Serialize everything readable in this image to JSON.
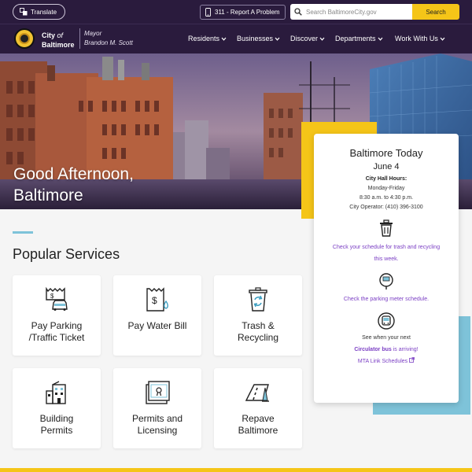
{
  "topbar": {
    "translate_label": "Translate",
    "report_label": "311 - Report A Problem",
    "search_placeholder": "Search BaltimoreCity.gov",
    "search_button": "Search"
  },
  "brand": {
    "city_line1_prefix": "City",
    "city_line1_of": "of",
    "city_line2": "Baltimore",
    "mayor_title": "Mayor",
    "mayor_name": "Brandon M. Scott"
  },
  "nav": {
    "items": [
      {
        "label": "Residents"
      },
      {
        "label": "Businesses"
      },
      {
        "label": "Discover"
      },
      {
        "label": "Departments"
      },
      {
        "label": "Work With Us"
      }
    ]
  },
  "hero": {
    "greeting_line1": "Good Afternoon,",
    "greeting_line2": "Baltimore"
  },
  "today": {
    "title": "Baltimore Today",
    "date": "June 4",
    "hours_title": "City Hall Hours:",
    "hours_days": "Monday-Friday",
    "hours_time": "8:30 a.m. to 4:30 p.m.",
    "operator": "City Operator: (410) 396-3100",
    "trash_link_line1": "Check your schedule for trash and recycling",
    "trash_link_line2": "this week.",
    "parking_link": "Check the parking meter schedule.",
    "bus_text": "See when your next",
    "bus_link": "Circulator bus",
    "bus_text2": " is arriving!",
    "mta_link": "MTA Link Schedules"
  },
  "services": {
    "title": "Popular Services",
    "items": [
      {
        "line1": "Pay Parking",
        "line2": "/Traffic Ticket",
        "icon": "parking-ticket-icon"
      },
      {
        "line1": "Pay Water Bill",
        "line2": "",
        "icon": "water-bill-icon"
      },
      {
        "line1": "Trash &",
        "line2": "Recycling",
        "icon": "recycling-bin-icon"
      },
      {
        "line1": "Building",
        "line2": "Permits",
        "icon": "building-icon"
      },
      {
        "line1": "Permits and",
        "line2": "Licensing",
        "icon": "certificate-icon"
      },
      {
        "line1": "Repave",
        "line2": "Baltimore",
        "icon": "road-icon"
      }
    ]
  },
  "colors": {
    "navy": "#2a1b3d",
    "yellow": "#f5c518",
    "blue_accent": "#7ec3d9",
    "link_purple": "#7b3fc4"
  }
}
